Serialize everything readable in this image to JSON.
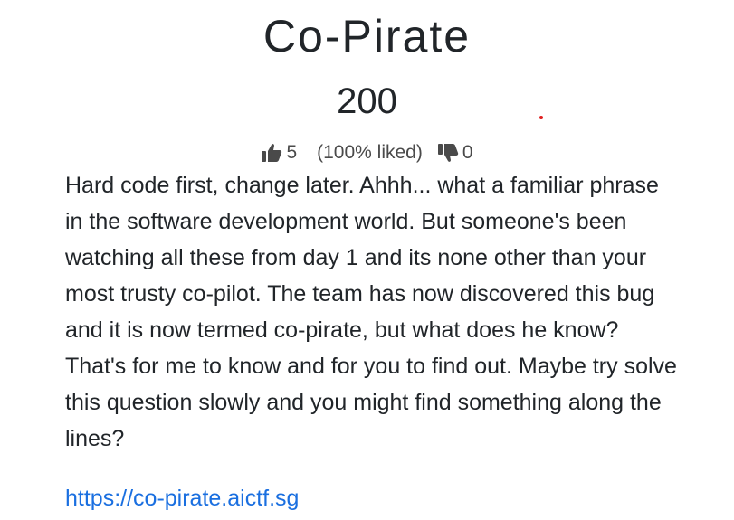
{
  "challenge": {
    "name": "Co-Pirate",
    "value": "200",
    "ratings": {
      "likes": "5",
      "liked_percent": "(100% liked)",
      "dislikes": "0"
    },
    "description": "Hard code first, change later. Ahhh... what a familiar phrase in the software development world. But someone's been watching all these from day 1 and its none other than your most trusty co-pilot. The team has now discovered this bug and it is now termed co-pirate, but what does he know? That's for me to know and for you to find out. Maybe try solve this question slowly and you might find something along the lines?",
    "link": {
      "text": "https://co-pirate.aictf.sg",
      "href": "https://co-pirate.aictf.sg"
    }
  },
  "icons": {
    "like": "thumbs-up-icon",
    "dislike": "thumbs-down-icon"
  },
  "colors": {
    "link": "#1a6fe0",
    "text": "#212529",
    "muted": "#4a4a4a"
  }
}
